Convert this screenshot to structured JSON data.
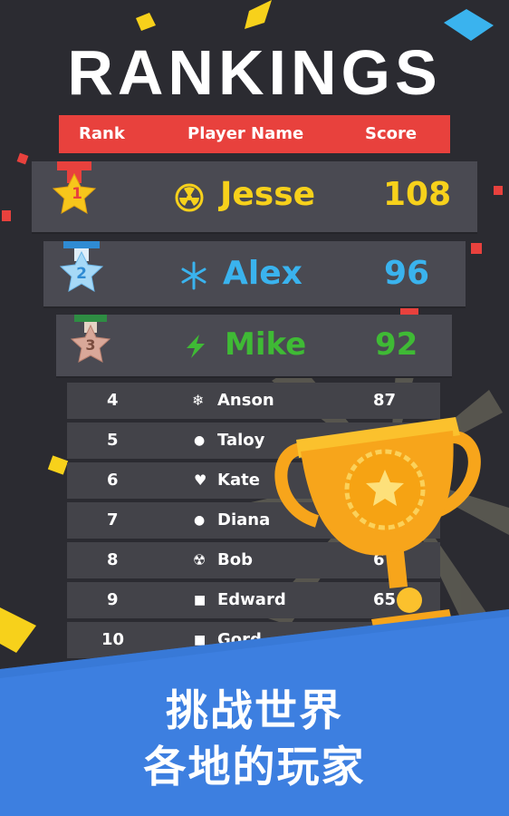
{
  "title": "RANKINGS",
  "columns": {
    "rank": "Rank",
    "player": "Player Name",
    "score": "Score"
  },
  "top3": [
    {
      "rank": "1",
      "icon": "radiation-icon",
      "name": "Jesse",
      "score": "108",
      "color": "#f7d11b",
      "medal": "#e8413d"
    },
    {
      "rank": "2",
      "icon": "snowflake-icon",
      "name": "Alex",
      "score": "96",
      "color": "#3ab3ee",
      "medal": "#2f8bd3"
    },
    {
      "rank": "3",
      "icon": "lightning-icon",
      "name": "Mike",
      "score": "92",
      "color": "#3fba35",
      "medal": "#2e8d43"
    }
  ],
  "rows": [
    {
      "rank": "4",
      "icon": "snowflake-icon",
      "glyph": "❄",
      "name": "Anson",
      "score": "87"
    },
    {
      "rank": "5",
      "icon": "dot-icon",
      "glyph": "●",
      "name": "Taloy",
      "score": ""
    },
    {
      "rank": "6",
      "icon": "heart-icon",
      "glyph": "♥",
      "name": "Kate",
      "score": ""
    },
    {
      "rank": "7",
      "icon": "dot-icon",
      "glyph": "●",
      "name": "Diana",
      "score": ""
    },
    {
      "rank": "8",
      "icon": "radiation-icon",
      "glyph": "☢",
      "name": "Bob",
      "score": "6"
    },
    {
      "rank": "9",
      "icon": "square-icon",
      "glyph": "■",
      "name": "Edward",
      "score": "65"
    },
    {
      "rank": "10",
      "icon": "square-icon",
      "glyph": "■",
      "name": "Gord",
      "score": ""
    }
  ],
  "slogan": {
    "line1": "挑战世界",
    "line2": "各地的玩家"
  },
  "colors": {
    "background": "#2b2b31",
    "header": "#e8413d",
    "banner": "#3d7fe0",
    "trophy": "#f7a51b"
  }
}
